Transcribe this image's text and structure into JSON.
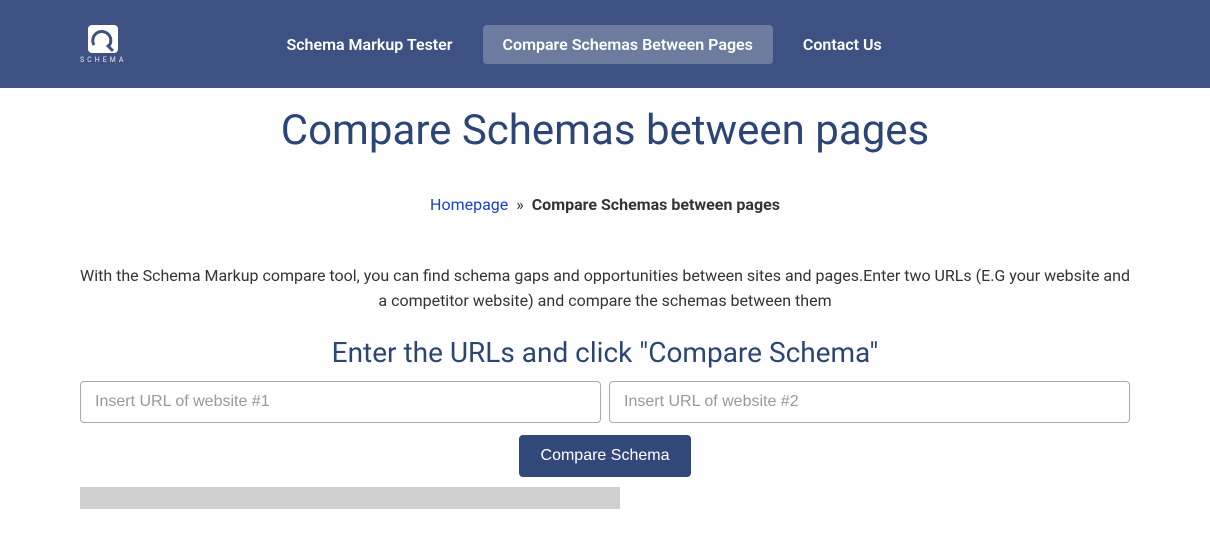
{
  "header": {
    "logo_text": "SCHEMA",
    "nav": [
      {
        "label": "Schema Markup Tester",
        "active": false
      },
      {
        "label": "Compare Schemas Between Pages",
        "active": true
      },
      {
        "label": "Contact Us",
        "active": false
      }
    ]
  },
  "page": {
    "title": "Compare Schemas between pages"
  },
  "breadcrumb": {
    "home": "Homepage",
    "separator": "»",
    "current": "Compare Schemas between pages"
  },
  "description": "With the Schema Markup compare tool, you can find schema gaps and opportunities between sites and pages.Enter two URLs (E.G your website and a competitor website) and compare the schemas between them",
  "form": {
    "title": "Enter the URLs and click \"Compare Schema\"",
    "url1_placeholder": "Insert URL of website #1",
    "url2_placeholder": "Insert URL of website #2",
    "submit_label": "Compare Schema"
  }
}
